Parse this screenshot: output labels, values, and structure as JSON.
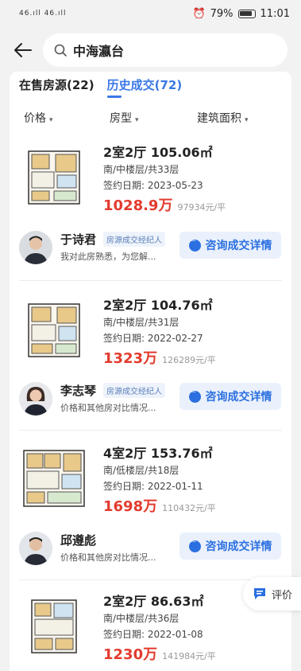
{
  "status_bar": {
    "signal": "46.ıll 46.ıll",
    "battery": "79%",
    "time": "11:01"
  },
  "header": {
    "search_query": "中海瀛台"
  },
  "tabs": [
    {
      "label": "在售房源(22)"
    },
    {
      "label": "历史成交(72)"
    }
  ],
  "filters": [
    {
      "label": "价格"
    },
    {
      "label": "房型"
    },
    {
      "label": "建筑面积"
    }
  ],
  "listings": [
    {
      "title": "2室2厅 105.06㎡",
      "orientation_floor": "南/中楼层/共33层",
      "sign_date": "签约日期: 2023-05-23",
      "total_price": "1028.9万",
      "unit_price": "97934元/平",
      "agent": {
        "name": "于诗君",
        "tag": "房源成交经纪人",
        "desc": "我对此房熟悉，为您解...",
        "button": "咨询成交详情"
      }
    },
    {
      "title": "2室2厅 104.76㎡",
      "orientation_floor": "南/中楼层/共31层",
      "sign_date": "签约日期: 2022-02-27",
      "total_price": "1323万",
      "unit_price": "126289元/平",
      "agent": {
        "name": "李志琴",
        "tag": "房源成交经纪人",
        "desc": "价格和其他房对比情况...",
        "button": "咨询成交详情"
      }
    },
    {
      "title": "4室2厅 153.76㎡",
      "orientation_floor": "南/低楼层/共18层",
      "sign_date": "签约日期: 2022-01-11",
      "total_price": "1698万",
      "unit_price": "110432元/平",
      "agent": {
        "name": "邱遵彪",
        "tag": "",
        "desc": "价格和其他房对比情况...",
        "button": "咨询成交详情"
      }
    },
    {
      "title": "2室2厅 86.63㎡",
      "orientation_floor": "南/中楼层/共36层",
      "sign_date": "签约日期: 2022-01-08",
      "total_price": "1230万",
      "unit_price": "141984元/平"
    }
  ],
  "float_button": {
    "label": "评价"
  },
  "colors": {
    "accent_blue": "#2b6fe0",
    "price_red": "#e33b2e"
  }
}
